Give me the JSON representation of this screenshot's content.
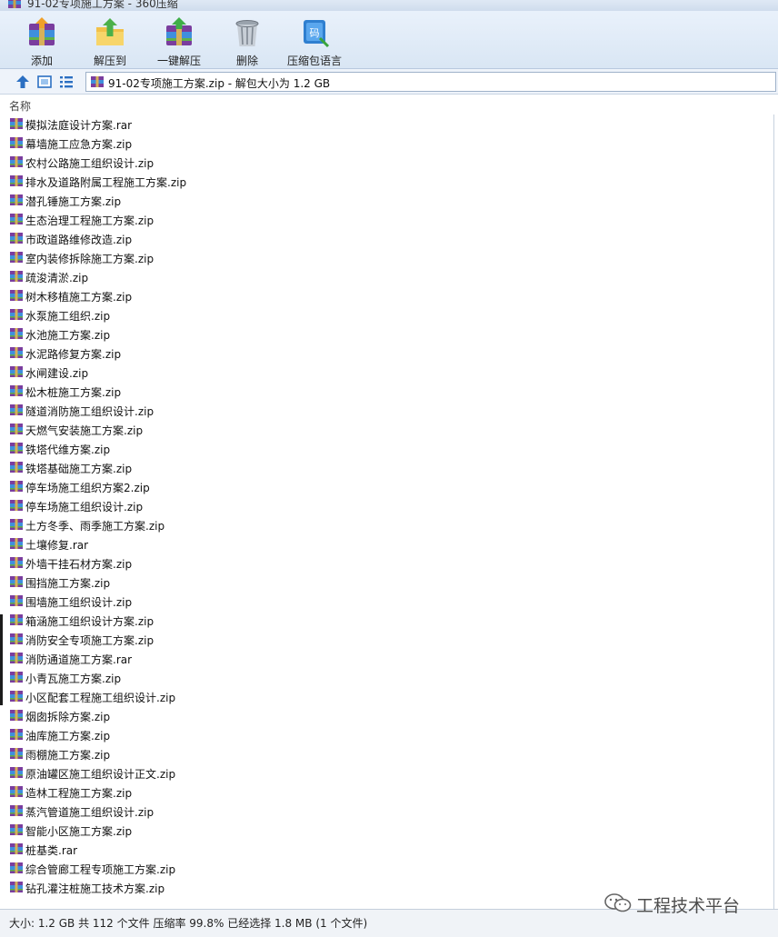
{
  "window": {
    "title": "91-02专项施工方案 - 360压缩"
  },
  "toolbar": {
    "buttons": [
      {
        "id": "add",
        "label": "添加",
        "icon": "add-archive-icon"
      },
      {
        "id": "extract_to",
        "label": "解压到",
        "icon": "extract-to-icon"
      },
      {
        "id": "one_click",
        "label": "一键解压",
        "icon": "one-click-extract-icon"
      },
      {
        "id": "delete",
        "label": "删除",
        "icon": "trash-icon"
      },
      {
        "id": "lang",
        "label": "压缩包语言",
        "icon": "archive-language-icon"
      }
    ]
  },
  "address": {
    "path": "91-02专项施工方案.zip - 解包大小为 1.2 GB"
  },
  "columns": {
    "name": "名称"
  },
  "files": [
    "模拟法庭设计方案.rar",
    "幕墙施工应急方案.zip",
    "农村公路施工组织设计.zip",
    "排水及道路附属工程施工方案.zip",
    "潜孔锤施工方案.zip",
    "生态治理工程施工方案.zip",
    "市政道路维修改造.zip",
    "室内装修拆除施工方案.zip",
    "疏浚清淤.zip",
    "树木移植施工方案.zip",
    "水泵施工组织.zip",
    "水池施工方案.zip",
    "水泥路修复方案.zip",
    "水闸建设.zip",
    "松木桩施工方案.zip",
    "隧道消防施工组织设计.zip",
    "天燃气安装施工方案.zip",
    "铁塔代维方案.zip",
    "铁塔基础施工方案.zip",
    "停车场施工组织方案2.zip",
    "停车场施工组织设计.zip",
    "土方冬季、雨季施工方案.zip",
    "土壤修复.rar",
    "外墙干挂石材方案.zip",
    "围挡施工方案.zip",
    "围墙施工组织设计.zip",
    "箱涵施工组织设计方案.zip",
    "消防安全专项施工方案.zip",
    "消防通道施工方案.rar",
    "小青瓦施工方案.zip",
    "小区配套工程施工组织设计.zip",
    "烟囱拆除方案.zip",
    "油库施工方案.zip",
    "雨棚施工方案.zip",
    "原油罐区施工组织设计正文.zip",
    "造林工程施工方案.zip",
    "蒸汽管道施工组织设计.zip",
    "智能小区施工方案.zip",
    "桩基类.rar",
    "综合管廊工程专项施工方案.zip",
    "钻孔灌注桩施工技术方案.zip"
  ],
  "status": {
    "text": "大小: 1.2 GB 共 112 个文件 压缩率 99.8% 已经选择 1.8 MB (1 个文件)"
  },
  "watermark": {
    "text": "工程技术平台",
    "icon": "wechat-icon"
  },
  "colors": {
    "toolbar_bg": "#e3edf8",
    "accent": "#2b6fc2"
  }
}
